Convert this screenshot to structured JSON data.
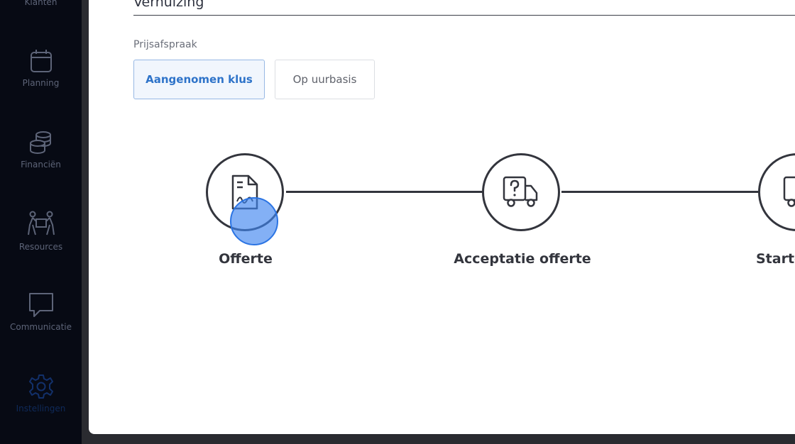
{
  "sidebar": {
    "items": [
      {
        "label": "Klanten",
        "icon": "users-icon"
      },
      {
        "label": "Planning",
        "icon": "calendar-icon"
      },
      {
        "label": "Financiën",
        "icon": "coins-icon"
      },
      {
        "label": "Resources",
        "icon": "people-box-icon"
      },
      {
        "label": "Communicatie",
        "icon": "chat-icon"
      },
      {
        "label": "Instellingen",
        "icon": "gear-icon"
      }
    ]
  },
  "form": {
    "job_type_value": "Verhuizing",
    "price_label": "Prijsafspraak",
    "price_options": [
      "Aangenomen klus",
      "Op uurbasis"
    ],
    "selected_price_option": "Aangenomen klus"
  },
  "steps": [
    {
      "label": "Offerte",
      "icon": "document-signature-icon"
    },
    {
      "label": "Acceptatie offerte",
      "icon": "truck-question-icon"
    },
    {
      "label": "Starten",
      "icon": "truck-icon"
    }
  ],
  "colors": {
    "sidebar_bg": "#070a14",
    "accent": "#2e73c9",
    "step_stroke": "#33353d"
  }
}
